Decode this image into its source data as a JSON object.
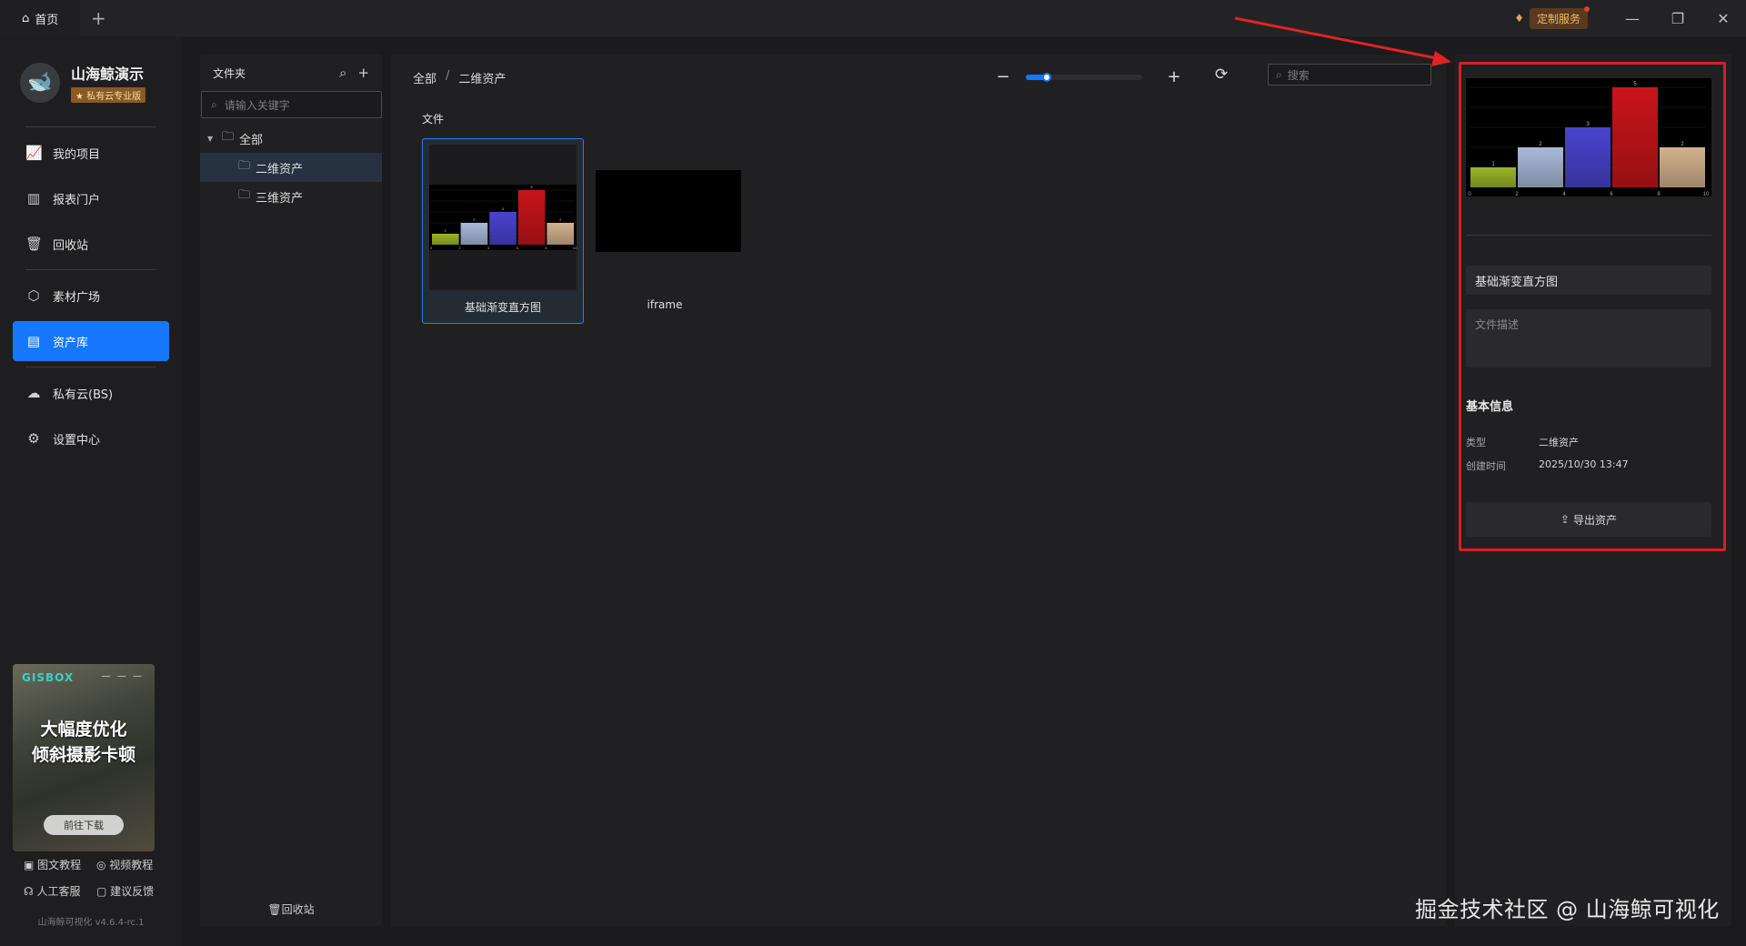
{
  "titlebar": {
    "home_tab": "首页",
    "add_tab": "+",
    "custom_service": "定制服务",
    "minimize": "—",
    "restore": "❐",
    "close": "✕"
  },
  "sidebar": {
    "brand_name": "山海鲸演示",
    "brand_badge": "★ 私有云专业版",
    "items": [
      {
        "label": "我的项目",
        "icon": "chart-line-icon"
      },
      {
        "label": "报表门户",
        "icon": "bar-report-icon"
      },
      {
        "label": "回收站",
        "icon": "trash-icon"
      },
      {
        "label": "素材广场",
        "icon": "cube-icon"
      },
      {
        "label": "资产库",
        "icon": "asset-box-icon",
        "active": true
      },
      {
        "label": "私有云(BS)",
        "icon": "cloud-icon"
      },
      {
        "label": "设置中心",
        "icon": "gear-icon"
      }
    ],
    "promo": {
      "logo": "GISBOX",
      "title_line1": "大幅度优化",
      "title_line2": "倾斜摄影卡顿",
      "button": "前往下载"
    },
    "help": {
      "doc_tutorial": "图文教程",
      "video_tutorial": "视频教程",
      "support": "人工客服",
      "feedback": "建议反馈"
    },
    "version": "山海鲸可视化 v4.6.4-rc.1"
  },
  "folder_panel": {
    "title": "文件夹",
    "search_placeholder": "请输入关键字",
    "tree": {
      "root": "全部",
      "children": [
        "二维资产",
        "三维资产"
      ],
      "selected": "二维资产"
    },
    "recycle": "回收站"
  },
  "main": {
    "breadcrumb": [
      "全部",
      "二维资产"
    ],
    "breadcrumb_sep": "/",
    "zoom_level": 0.18,
    "search_placeholder": "搜索",
    "section_label": "文件",
    "files": [
      {
        "name": "基础渐变直方图",
        "selected": true
      },
      {
        "name": "iframe",
        "selected": false
      }
    ]
  },
  "properties": {
    "name_value": "基础渐变直方图",
    "description_placeholder": "文件描述",
    "basic_info_title": "基本信息",
    "type_label": "类型",
    "type_value": "二维资产",
    "created_label": "创建时间",
    "created_value": "2025/10/30 13:47",
    "export_button": "导出资产"
  },
  "chart_data": {
    "type": "bar",
    "categories": [
      "0-2",
      "2-4",
      "4-6",
      "6-8",
      "8-10"
    ],
    "values": [
      1,
      2,
      3,
      5,
      2
    ],
    "x_ticks": [
      "0",
      "2",
      "4",
      "6",
      "8",
      "10"
    ],
    "ylim": [
      0,
      5
    ],
    "colors": [
      "#9bb52a",
      "#a9b9da",
      "#4a43cf",
      "#c8151a",
      "#d3b28c"
    ]
  },
  "watermark": "掘金技术社区 @ 山海鲸可视化"
}
